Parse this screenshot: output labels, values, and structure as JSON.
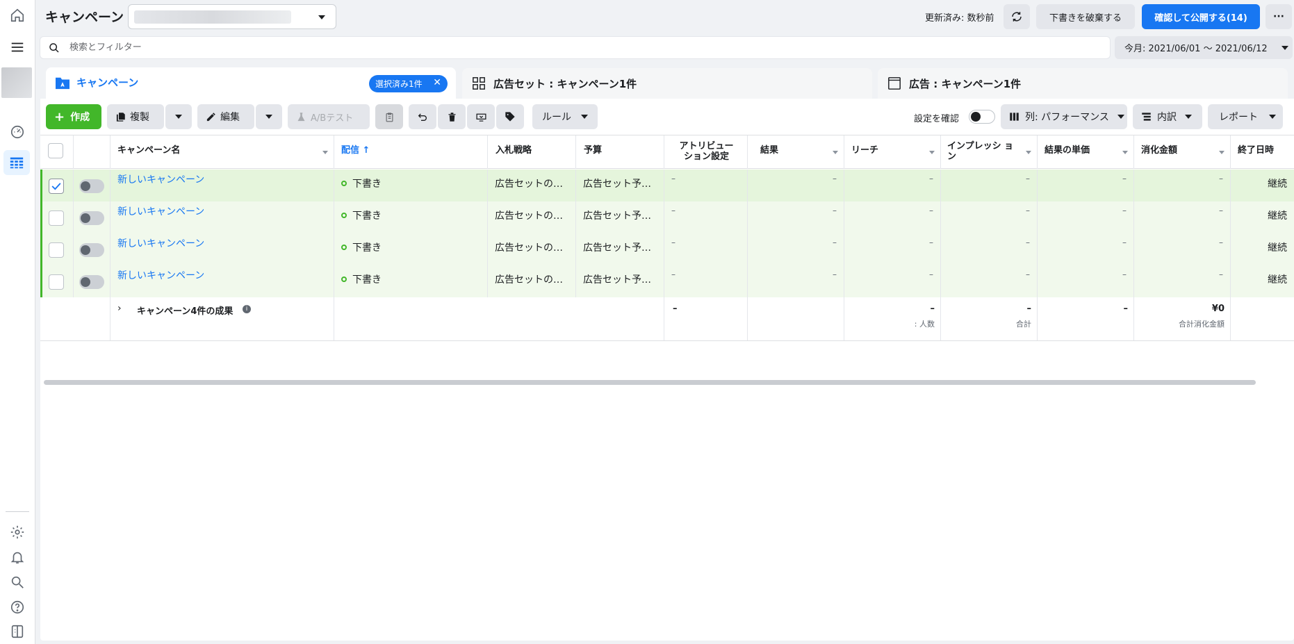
{
  "topbar": {
    "title": "キャンペーン",
    "updated": "更新済み: 数秒前",
    "discard": "下書きを破棄する",
    "publish": "確認して公開する(14)",
    "more": "···"
  },
  "search": {
    "placeholder": "検索とフィルター"
  },
  "date_range": "今月: 2021/06/01 ～ 2021/06/12",
  "tabs": {
    "campaign": "キャンペーン",
    "selected_chip": "選択済み1件",
    "adset": "広告セット : キャンペーン1件",
    "ad": "広告 : キャンペーン1件"
  },
  "toolbar": {
    "create": "作成",
    "duplicate": "複製",
    "edit": "編集",
    "ab_test": "A/Bテスト",
    "rules": "ルール",
    "review_settings": "設定を確認",
    "columns": "列: パフォーマンス",
    "breakdown": "内訳",
    "report": "レポート"
  },
  "table": {
    "headers": {
      "name": "キャンペーン名",
      "delivery": "配信 ↑",
      "bid": "入札戦略",
      "budget": "予算",
      "attribution": "アトリビュー ション設定",
      "results": "結果",
      "reach": "リーチ",
      "impressions": "インプレッシ ョン",
      "cost_per_result": "結果の単価",
      "spent": "消化金額",
      "end": "終了日時"
    },
    "rows": [
      {
        "name": "新しいキャンペーン",
        "delivery": "下書き",
        "bid": "広告セットの…",
        "budget": "広告セット予…",
        "attribution": "–",
        "results": "–",
        "reach": "–",
        "impressions": "–",
        "cost": "–",
        "spent": "–",
        "end": "継続",
        "selected": true
      },
      {
        "name": "新しいキャンペーン",
        "delivery": "下書き",
        "bid": "広告セットの…",
        "budget": "広告セット予…",
        "attribution": "–",
        "results": "–",
        "reach": "–",
        "impressions": "–",
        "cost": "–",
        "spent": "–",
        "end": "継続",
        "selected": false
      },
      {
        "name": "新しいキャンペーン",
        "delivery": "下書き",
        "bid": "広告セットの…",
        "budget": "広告セット予…",
        "attribution": "–",
        "results": "–",
        "reach": "–",
        "impressions": "–",
        "cost": "–",
        "spent": "–",
        "end": "継続",
        "selected": false
      },
      {
        "name": "新しいキャンペーン",
        "delivery": "下書き",
        "bid": "広告セットの…",
        "budget": "広告セット予…",
        "attribution": "–",
        "results": "–",
        "reach": "–",
        "impressions": "–",
        "cost": "–",
        "spent": "–",
        "end": "継続",
        "selected": false
      }
    ],
    "summary": {
      "label": "キャンペーン4件の成果",
      "attribution": "–",
      "reach": "–",
      "reach_sub": ": 人数",
      "impressions": "–",
      "impressions_sub": "合計",
      "cost": "–",
      "spent": "¥0",
      "spent_sub": "合計消化金額"
    }
  },
  "colors": {
    "accent": "#1877f2",
    "create": "#42b72a",
    "row_bg": "#f1f9ec"
  }
}
